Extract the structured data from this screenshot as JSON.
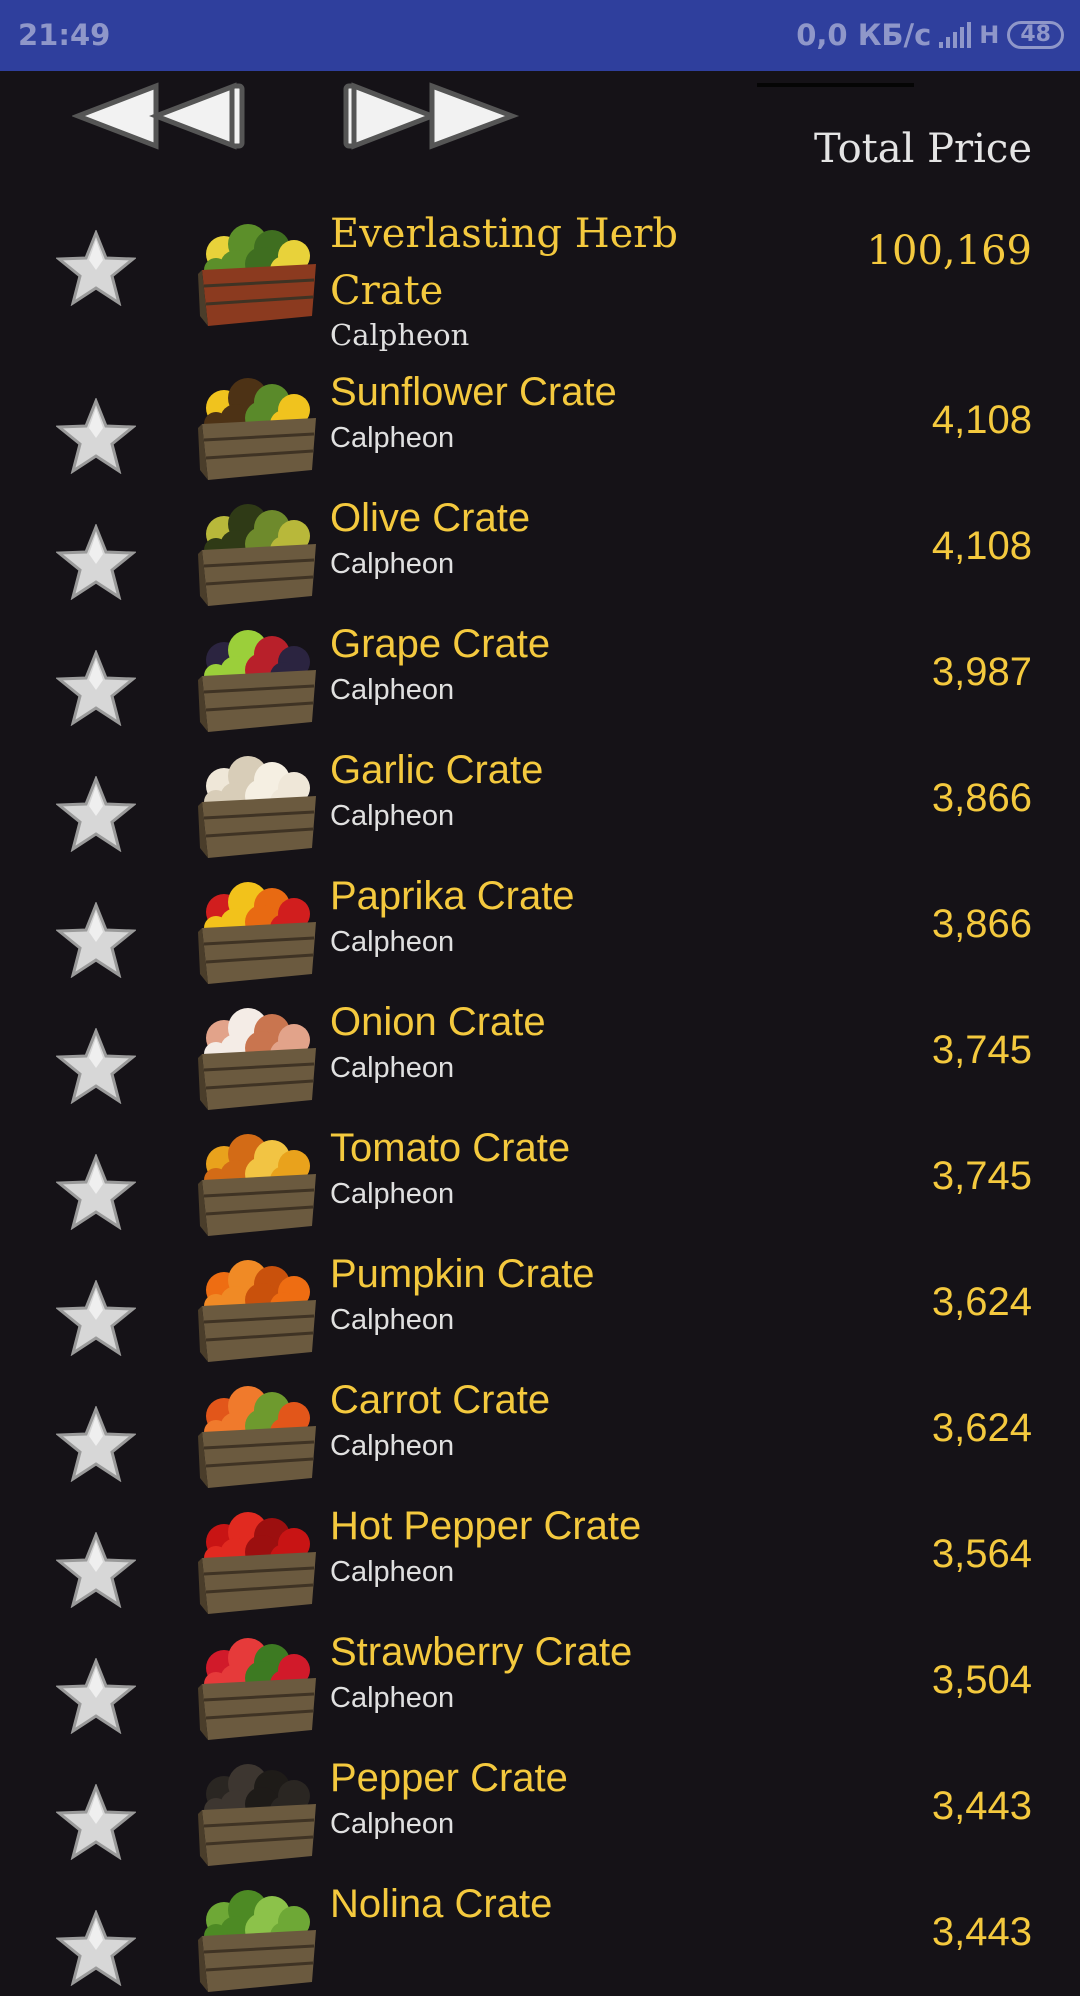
{
  "status_bar": {
    "time": "21:49",
    "network_speed": "0,0 КБ/с",
    "network_type": "H",
    "battery": "48"
  },
  "nav": {
    "prev_icon": "double-left-arrow",
    "next_icon": "double-right-arrow"
  },
  "header": {
    "total_price_label": "Total Price"
  },
  "items": [
    {
      "name": "Everlasting Herb Crate",
      "location": "Calpheon",
      "price": "100,169",
      "icon": "herb-crate"
    },
    {
      "name": "Sunflower Crate",
      "location": "Calpheon",
      "price": "4,108",
      "icon": "sunflower-crate"
    },
    {
      "name": "Olive Crate",
      "location": "Calpheon",
      "price": "4,108",
      "icon": "olive-crate"
    },
    {
      "name": "Grape Crate",
      "location": "Calpheon",
      "price": "3,987",
      "icon": "grape-crate"
    },
    {
      "name": "Garlic Crate",
      "location": "Calpheon",
      "price": "3,866",
      "icon": "garlic-crate"
    },
    {
      "name": "Paprika Crate",
      "location": "Calpheon",
      "price": "3,866",
      "icon": "paprika-crate"
    },
    {
      "name": "Onion Crate",
      "location": "Calpheon",
      "price": "3,745",
      "icon": "onion-crate"
    },
    {
      "name": "Tomato Crate",
      "location": "Calpheon",
      "price": "3,745",
      "icon": "tomato-crate"
    },
    {
      "name": "Pumpkin Crate",
      "location": "Calpheon",
      "price": "3,624",
      "icon": "pumpkin-crate"
    },
    {
      "name": "Carrot Crate",
      "location": "Calpheon",
      "price": "3,624",
      "icon": "carrot-crate"
    },
    {
      "name": "Hot Pepper Crate",
      "location": "Calpheon",
      "price": "3,564",
      "icon": "hot-pepper-crate"
    },
    {
      "name": "Strawberry Crate",
      "location": "Calpheon",
      "price": "3,504",
      "icon": "strawberry-crate"
    },
    {
      "name": "Pepper Crate",
      "location": "Calpheon",
      "price": "3,443",
      "icon": "pepper-crate"
    },
    {
      "name": "Nolina Crate",
      "location": "",
      "price": "3,443",
      "icon": "nolina-crate"
    }
  ],
  "colors": {
    "status_bar": "#2f3f9d",
    "background": "#151217",
    "item_name": "#f4c93e",
    "price": "#f4c93e",
    "location": "#e0e0e0",
    "crate_wood": "#6b5a3f",
    "herb_crate_wood": "#8b3a1f"
  },
  "produce_colors": {
    "herb-crate": [
      "#e8d23a",
      "#5c8f2a",
      "#3f6e20"
    ],
    "sunflower-crate": [
      "#f0c31e",
      "#4d3215",
      "#5a8a2a"
    ],
    "olive-crate": [
      "#b8b83a",
      "#2f3a16",
      "#6e8a2c"
    ],
    "grape-crate": [
      "#2b2440",
      "#9bcf3a",
      "#b8202a"
    ],
    "garlic-crate": [
      "#efe7d8",
      "#d8cdb8",
      "#f5efe2"
    ],
    "paprika-crate": [
      "#d11e1e",
      "#f2c21b",
      "#e86a12"
    ],
    "onion-crate": [
      "#e2a38a",
      "#f4ece6",
      "#c9754f"
    ],
    "tomato-crate": [
      "#e9a21c",
      "#d36b16",
      "#f2c443"
    ],
    "pumpkin-crate": [
      "#ee6d12",
      "#f08a25",
      "#c9510c"
    ],
    "carrot-crate": [
      "#e2561a",
      "#f07a2c",
      "#6e9a2e"
    ],
    "hot-pepper-crate": [
      "#c81414",
      "#e12a20",
      "#9c0f0f"
    ],
    "strawberry-crate": [
      "#d11a2a",
      "#e63a3a",
      "#3d7a22"
    ],
    "pepper-crate": [
      "#2a2622",
      "#3d3630",
      "#1e1b18"
    ],
    "nolina-crate": [
      "#6ea836",
      "#4d8a24",
      "#8cc24a"
    ]
  }
}
